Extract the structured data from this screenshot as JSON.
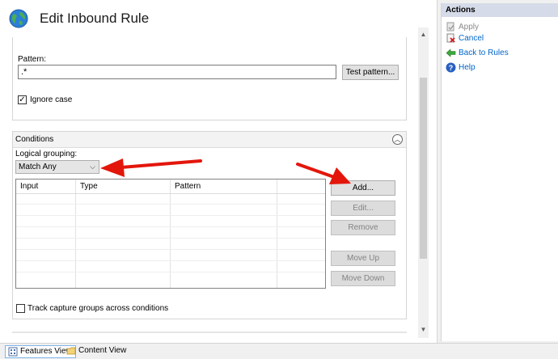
{
  "header": {
    "title": "Edit Inbound Rule",
    "icon": "globe-icon"
  },
  "pattern_section": {
    "pattern_label": "Pattern:",
    "pattern_value": ".*",
    "test_button": "Test pattern...",
    "ignore_case_label": "Ignore case",
    "ignore_case_checked": true
  },
  "conditions": {
    "title": "Conditions",
    "logical_grouping_label": "Logical grouping:",
    "logical_grouping_value": "Match Any",
    "columns": [
      "Input",
      "Type",
      "Pattern",
      ""
    ],
    "rows": [],
    "buttons": {
      "add": "Add...",
      "edit": "Edit...",
      "remove": "Remove",
      "move_up": "Move Up",
      "move_down": "Move Down"
    },
    "track_capture_label": "Track capture groups across conditions",
    "track_capture_checked": false
  },
  "tabs": [
    {
      "label": "Features View",
      "active": true
    },
    {
      "label": "Content View",
      "active": false
    }
  ],
  "actions": {
    "title": "Actions",
    "items": [
      {
        "label": "Apply",
        "icon": "apply-icon",
        "enabled": false
      },
      {
        "label": "Cancel",
        "icon": "cancel-icon",
        "enabled": true
      },
      {
        "label": "Back to Rules",
        "icon": "back-arrow-icon",
        "enabled": true
      },
      {
        "label": "Help",
        "icon": "help-icon",
        "enabled": true
      }
    ]
  },
  "colors": {
    "link": "#0066cc",
    "actions_header": "#d6dbe9",
    "annotation_arrow": "#e3160b"
  }
}
